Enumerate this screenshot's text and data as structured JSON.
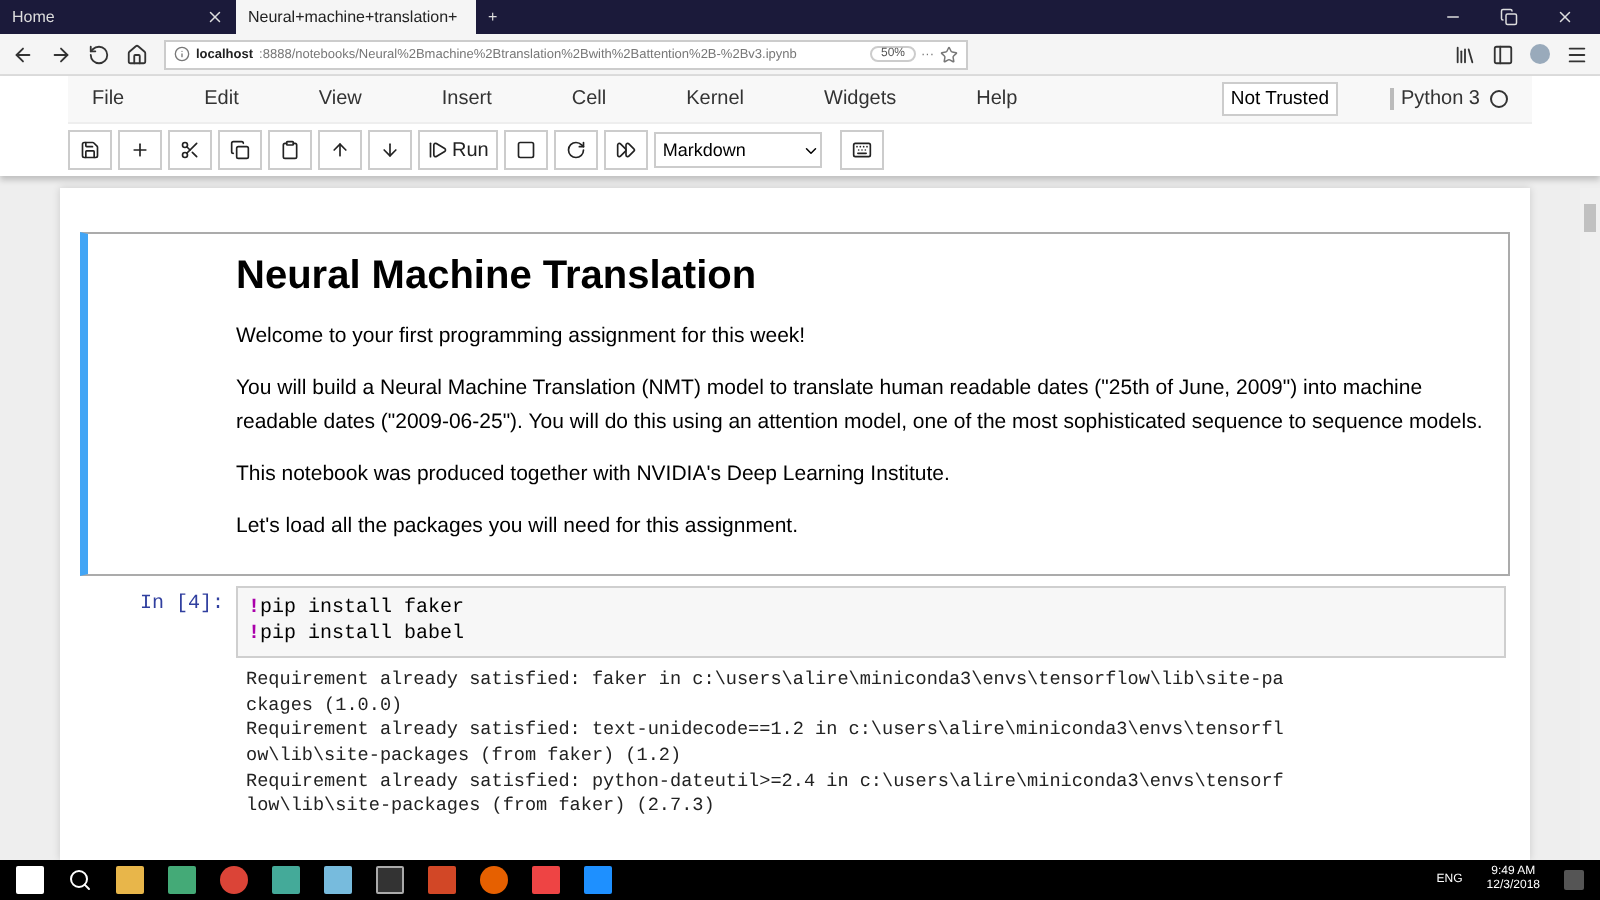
{
  "browser": {
    "tabs": [
      {
        "label": "Home",
        "selected": false
      },
      {
        "label": "Neural+machine+translation+",
        "selected": true
      }
    ],
    "new_tab": "+",
    "url_host": "localhost",
    "url_rest": ":8888/notebooks/Neural%2Bmachine%2Btranslation%2Bwith%2Battention%2B-%2Bv3.ipynb",
    "zoom": "50%",
    "more": "···"
  },
  "menu": [
    "File",
    "Edit",
    "View",
    "Insert",
    "Cell",
    "Kernel",
    "Widgets",
    "Help"
  ],
  "trust": "Not Trusted",
  "kernel": {
    "name": "Python 3",
    "busy": false
  },
  "toolbar": {
    "run": "Run",
    "cell_type": "Markdown"
  },
  "markdown_cell": {
    "selected": true,
    "title": "Neural Machine Translation",
    "paragraphs": [
      "Welcome to your first programming assignment for this week!",
      "You will build a Neural Machine Translation (NMT) model to translate human readable dates (\"25th of June, 2009\") into machine readable dates (\"2009-06-25\"). You will do this using an attention model, one of the most sophisticated sequence to sequence models.",
      "This notebook was produced together with NVIDIA's Deep Learning Institute.",
      "Let's load all the packages you will need for this assignment."
    ]
  },
  "code_cell": {
    "prompt": "In [4]:",
    "lines": [
      {
        "bang": "!",
        "text": "pip install faker"
      },
      {
        "bang": "!",
        "text": "pip install babel"
      }
    ],
    "output": [
      "Requirement already satisfied: faker in c:\\users\\alire\\miniconda3\\envs\\tensorflow\\lib\\site-pa",
      "ckages (1.0.0)",
      "Requirement already satisfied: text-unidecode==1.2 in c:\\users\\alire\\miniconda3\\envs\\tensorfl",
      "ow\\lib\\site-packages (from faker) (1.2)",
      "Requirement already satisfied: python-dateutil>=2.4 in c:\\users\\alire\\miniconda3\\envs\\tensorf",
      "low\\lib\\site-packages (from faker) (2.7.3)"
    ]
  },
  "taskbar": {
    "language": "ENG",
    "time": "9:49 AM",
    "date": "12/3/2018"
  }
}
